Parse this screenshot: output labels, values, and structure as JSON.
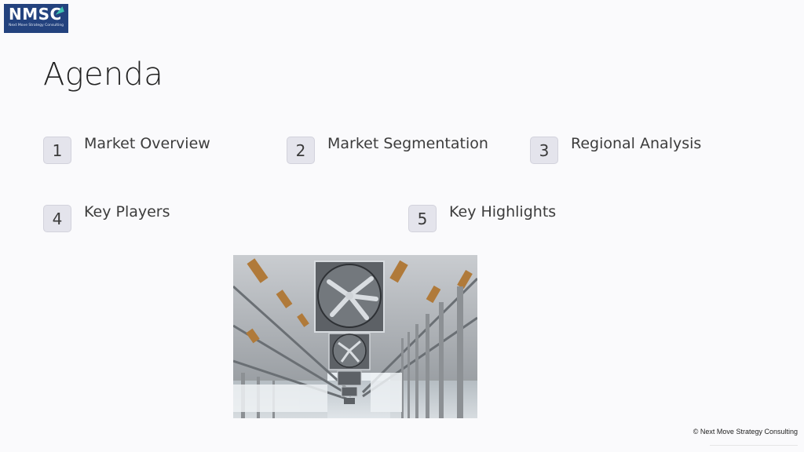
{
  "logo": {
    "text": "NMSC",
    "subtext": "Next Move Strategy Consulting"
  },
  "title": "Agenda",
  "agenda": [
    {
      "number": "1",
      "label": "Market Overview"
    },
    {
      "number": "2",
      "label": "Market Segmentation"
    },
    {
      "number": "3",
      "label": "Regional Analysis"
    },
    {
      "number": "4",
      "label": "Key Players"
    },
    {
      "number": "5",
      "label": "Key Highlights"
    }
  ],
  "image": {
    "subject": "barn-ventilation-fans-photo"
  },
  "footer": {
    "copyright": "© Next Move Strategy Consulting"
  },
  "colors": {
    "background": "#fafafc",
    "logo_bg": "#23427e",
    "logo_accent": "#3ec0b0",
    "number_box": "#e4e4ec"
  }
}
